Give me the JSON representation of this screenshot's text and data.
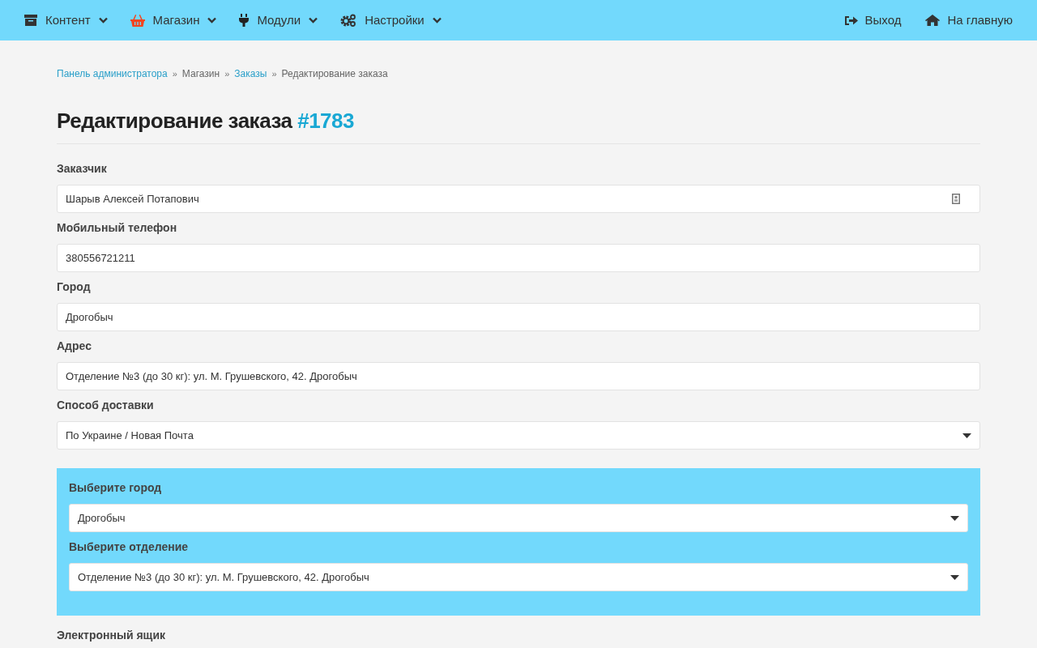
{
  "nav": {
    "menu": [
      {
        "label": "Контент"
      },
      {
        "label": "Магазин"
      },
      {
        "label": "Модули"
      },
      {
        "label": "Настройки"
      }
    ],
    "right": [
      {
        "label": "Выход"
      },
      {
        "label": "На главную"
      }
    ]
  },
  "breadcrumb": [
    {
      "label": "Панель администратора",
      "kind": "link"
    },
    {
      "label": "»",
      "kind": "separator"
    },
    {
      "label": "Магазин",
      "kind": "text"
    },
    {
      "label": "»",
      "kind": "separator"
    },
    {
      "label": "Заказы",
      "kind": "link"
    },
    {
      "label": "»",
      "kind": "separator"
    },
    {
      "label": "Редактирование заказа",
      "kind": "text"
    }
  ],
  "title": {
    "text": "Редактирование заказа",
    "order_number": "#1783"
  },
  "fields": [
    {
      "label": "Заказчик",
      "value": "Шарыв Алексей Потапович",
      "kind": "lookup"
    },
    {
      "label": "Мобильный телефон",
      "value": "380556721211",
      "kind": "input"
    },
    {
      "label": "Город",
      "value": "Дрогобыч",
      "kind": "input"
    },
    {
      "label": "Адрес",
      "value": "Отделение №3 (до 30 кг): ул. М. Грушевского, 42. Дрогобыч",
      "kind": "input"
    },
    {
      "label": "Способ доставки",
      "value": "По Украине / Новая Почта",
      "kind": "select"
    }
  ],
  "delivery_panel": [
    {
      "label": "Выберите город",
      "value": "Дрогобыч",
      "kind": "select"
    },
    {
      "label": "Выберите отделение",
      "value": "Отделение №3 (до 30 кг): ул. М. Грушевского, 42. Дрогобыч",
      "kind": "select"
    }
  ],
  "more_fields": [
    {
      "label": "Электронный ящик"
    }
  ]
}
